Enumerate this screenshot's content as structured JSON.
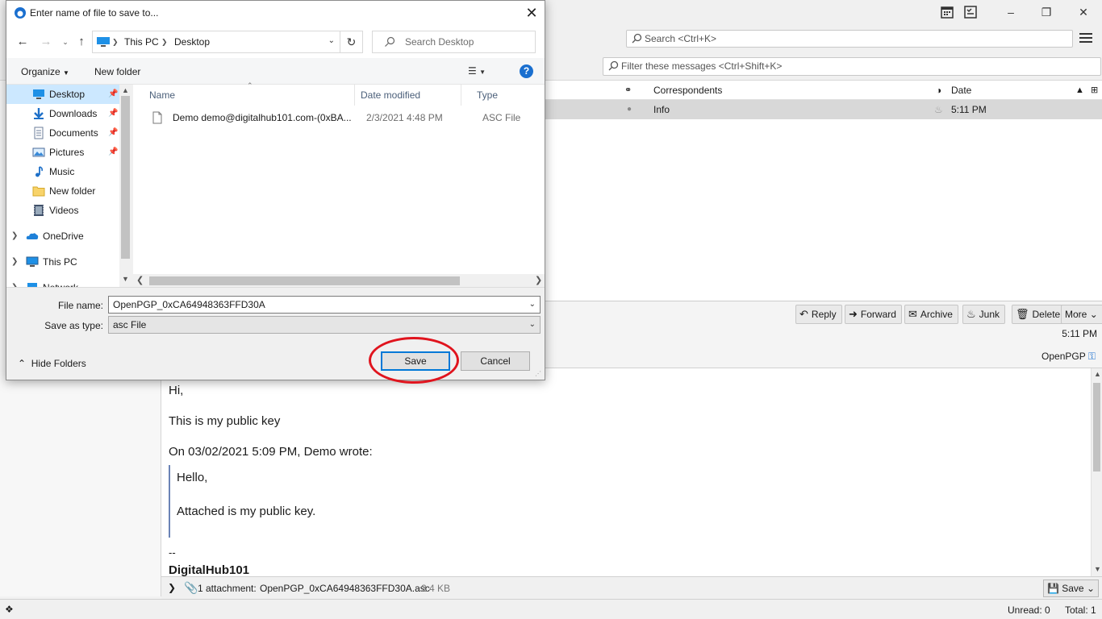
{
  "dialog": {
    "title": "Enter name of file to save to...",
    "address": {
      "crumbs": [
        "This PC",
        "Desktop"
      ]
    },
    "search_placeholder": "Search Desktop",
    "organize_label": "Organize",
    "new_folder_label": "New folder",
    "nav": {
      "quick_access": [
        {
          "label": "Desktop",
          "icon": "desktop-icon",
          "pinned": true,
          "selected": true
        },
        {
          "label": "Downloads",
          "icon": "download-icon",
          "pinned": true
        },
        {
          "label": "Documents",
          "icon": "documents-icon",
          "pinned": true
        },
        {
          "label": "Pictures",
          "icon": "pictures-icon",
          "pinned": true
        },
        {
          "label": "Music",
          "icon": "music-icon"
        },
        {
          "label": "New folder",
          "icon": "folder-icon"
        },
        {
          "label": "Videos",
          "icon": "videos-icon"
        }
      ],
      "roots": [
        {
          "label": "OneDrive",
          "icon": "onedrive-icon"
        },
        {
          "label": "This PC",
          "icon": "this-pc-icon"
        },
        {
          "label": "Network",
          "icon": "network-icon"
        }
      ]
    },
    "columns": [
      "Name",
      "Date modified",
      "Type"
    ],
    "files": [
      {
        "name": "Demo demo@digitalhub101.com-(0xBA...",
        "date": "2/3/2021 4:48 PM",
        "type": "ASC File"
      }
    ],
    "file_name_label": "File name:",
    "file_name_value": "OpenPGP_0xCA64948363FFD30A",
    "save_type_label": "Save as type:",
    "save_type_value": "asc File",
    "hide_folders_label": "Hide Folders",
    "save_label": "Save",
    "cancel_label": "Cancel",
    "annotation_color": "#e0141e"
  },
  "mail": {
    "search_placeholder": "Search <Ctrl+K>",
    "filter_placeholder": "Filter these messages <Ctrl+Shift+K>",
    "columns": {
      "correspondents": "Correspondents",
      "date": "Date"
    },
    "row": {
      "correspondent": "Info",
      "date": "5:11 PM"
    },
    "actions": [
      "Reply",
      "Forward",
      "Archive",
      "Junk",
      "Delete",
      "More"
    ],
    "header_time": "5:11 PM",
    "openpgp_label": "OpenPGP",
    "body": {
      "greeting": "Hi,",
      "line1": "This is my public key",
      "quote_intro": "On 03/02/2021 5:09 PM, Demo wrote:",
      "quote_line1": "Hello,",
      "quote_line2": "Attached is my public key.",
      "sig_sep": "--",
      "sig_name": "DigitalHub101"
    },
    "attachment": {
      "label": "1 attachment:",
      "filename": "OpenPGP_0xCA64948363FFD30A.asc",
      "size": "2.4 KB",
      "save_label": "Save"
    },
    "status": {
      "unread": "Unread: 0",
      "total": "Total: 1"
    }
  }
}
